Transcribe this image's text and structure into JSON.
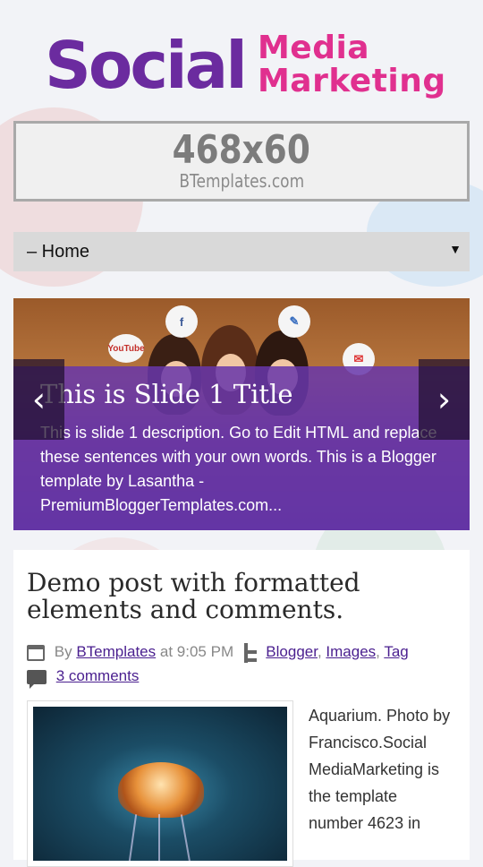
{
  "header": {
    "logo_social": "Social",
    "logo_media": "Media",
    "logo_marketing": "Marketing"
  },
  "ad": {
    "size_text": "468x60",
    "sub_text": "BTemplates.com"
  },
  "nav": {
    "selected": "– Home"
  },
  "slider": {
    "title": "This is Slide 1 Title",
    "description": "This is slide 1 description. Go to Edit HTML and replace these sentences with your own words. This is a Blogger template by Lasantha - PremiumBloggerTemplates.com...",
    "prev_symbol": "‹",
    "next_symbol": "›",
    "bubble_youtube": "YouTube",
    "bubble_facebook": "f"
  },
  "post": {
    "title": "Demo post with formatted elements and comments.",
    "by_label": "By",
    "author": "BTemplates",
    "time_prefix": "at",
    "time": "9:05 PM",
    "labels": [
      "Blogger",
      "Images",
      "Tag"
    ],
    "comments": "3 comments",
    "body_text": "Aquarium. Photo by Francisco.Social MediaMarketing is the template number 4623 in"
  },
  "colors": {
    "brand_purple": "#6b2b9f",
    "brand_pink": "#e0308f",
    "link": "#4a1f8f"
  }
}
